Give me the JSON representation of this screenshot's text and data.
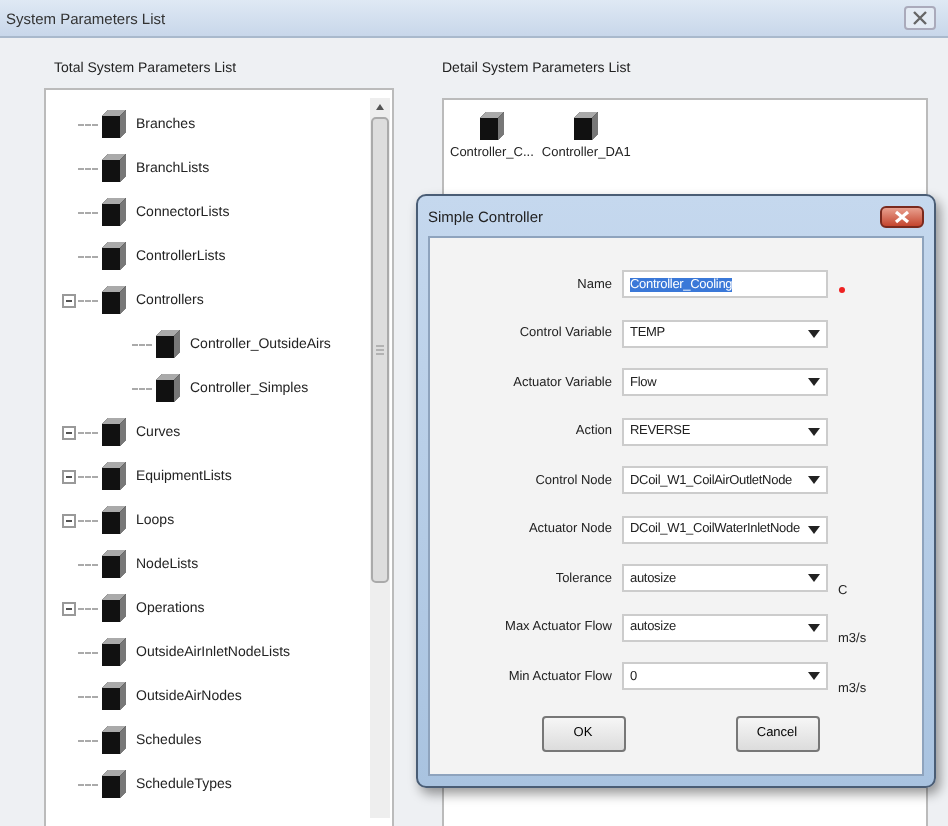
{
  "window": {
    "title": "System Parameters List"
  },
  "tree": {
    "label": "Total System Parameters List",
    "items": [
      {
        "label": "Branches",
        "kind": "leaf"
      },
      {
        "label": "BranchLists",
        "kind": "leaf"
      },
      {
        "label": "ConnectorLists",
        "kind": "leaf"
      },
      {
        "label": "ControllerLists",
        "kind": "leaf"
      },
      {
        "label": "Controllers",
        "kind": "group",
        "expanded": true,
        "children": [
          {
            "label": "Controller_OutsideAirs"
          },
          {
            "label": "Controller_Simples"
          }
        ]
      },
      {
        "label": "Curves",
        "kind": "group",
        "expanded": true
      },
      {
        "label": "EquipmentLists",
        "kind": "group",
        "expanded": true
      },
      {
        "label": "Loops",
        "kind": "group",
        "expanded": true
      },
      {
        "label": "NodeLists",
        "kind": "leaf"
      },
      {
        "label": "Operations",
        "kind": "group",
        "expanded": true
      },
      {
        "label": "OutsideAirInletNodeLists",
        "kind": "leaf"
      },
      {
        "label": "OutsideAirNodes",
        "kind": "leaf"
      },
      {
        "label": "Schedules",
        "kind": "leaf"
      },
      {
        "label": "ScheduleTypes",
        "kind": "leaf"
      }
    ]
  },
  "detail": {
    "label": "Detail System Parameters List",
    "items": [
      {
        "label": "Controller_C..."
      },
      {
        "label": "Controller_DA1"
      }
    ]
  },
  "dialog": {
    "title": "Simple Controller",
    "fields": [
      {
        "label": "Name",
        "kind": "text",
        "value": "Controller_Cooling",
        "text_selected": true,
        "required": true
      },
      {
        "label": "Control Variable",
        "kind": "select",
        "value": "TEMP"
      },
      {
        "label": "Actuator Variable",
        "kind": "select",
        "value": "Flow"
      },
      {
        "label": "Action",
        "kind": "select",
        "value": "REVERSE"
      },
      {
        "label": "Control Node",
        "kind": "select",
        "value": "DCoil_W1_CoilAirOutletNode"
      },
      {
        "label": "Actuator Node",
        "kind": "select",
        "value": "DCoil_W1_CoilWaterInletNode"
      },
      {
        "label": "Tolerance",
        "kind": "select",
        "value": "autosize",
        "unit": "C"
      },
      {
        "label": "Max Actuator Flow",
        "kind": "select",
        "value": "autosize",
        "unit": "m3/s"
      },
      {
        "label": "Min Actuator Flow",
        "kind": "select",
        "value": "0",
        "unit": "m3/s"
      }
    ],
    "buttons": [
      "OK",
      "Cancel"
    ]
  }
}
